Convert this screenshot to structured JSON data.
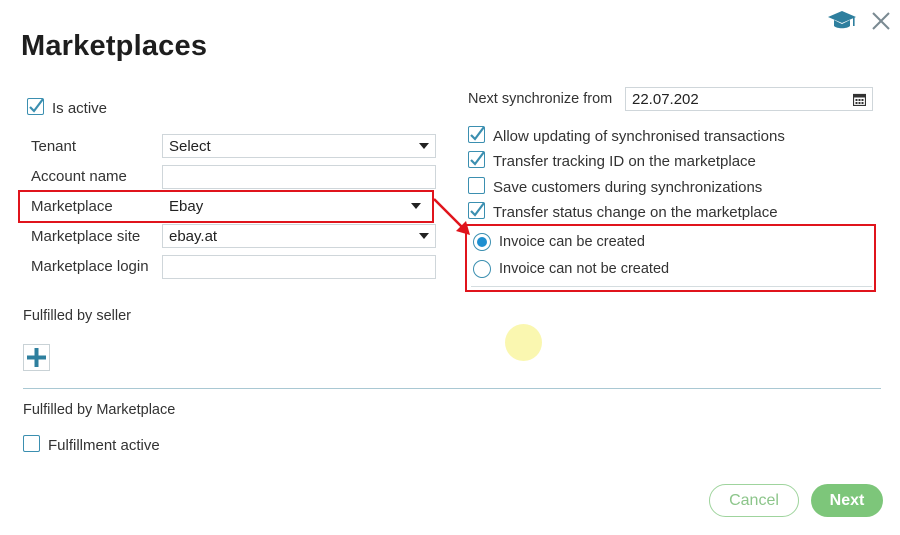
{
  "header": {
    "title": "Marketplaces",
    "help_icon": "graduation-cap-icon",
    "close_icon": "close-icon"
  },
  "left": {
    "is_active_label": "Is active",
    "tenant": {
      "label": "Tenant",
      "value": "Select"
    },
    "account_name": {
      "label": "Account name",
      "value": ""
    },
    "marketplace": {
      "label": "Marketplace",
      "value": "Ebay"
    },
    "marketplace_site": {
      "label": "Marketplace site",
      "value": "ebay.at"
    },
    "marketplace_login": {
      "label": "Marketplace login",
      "value": ""
    },
    "fulfilled_by_seller": "Fulfilled by seller",
    "fulfilled_by_marketplace": "Fulfilled by Marketplace",
    "fulfillment_active": "Fulfillment active"
  },
  "right": {
    "next_sync_label": "Next synchronize from",
    "next_sync_value": "22.07.202",
    "options": [
      {
        "label": "Allow updating of synchronised transactions",
        "checked": true
      },
      {
        "label": "Transfer tracking ID on the marketplace",
        "checked": true
      },
      {
        "label": "Save customers during synchronizations",
        "checked": false
      },
      {
        "label": "Transfer status change on the marketplace",
        "checked": true
      }
    ],
    "invoice": {
      "created": "Invoice can be created",
      "not_created": "Invoice can not be created",
      "selected": "created"
    }
  },
  "footer": {
    "cancel": "Cancel",
    "next": "Next"
  },
  "colors": {
    "accent": "#3b8fb0",
    "highlight": "#e0141c",
    "button_green": "#7dc67a"
  }
}
